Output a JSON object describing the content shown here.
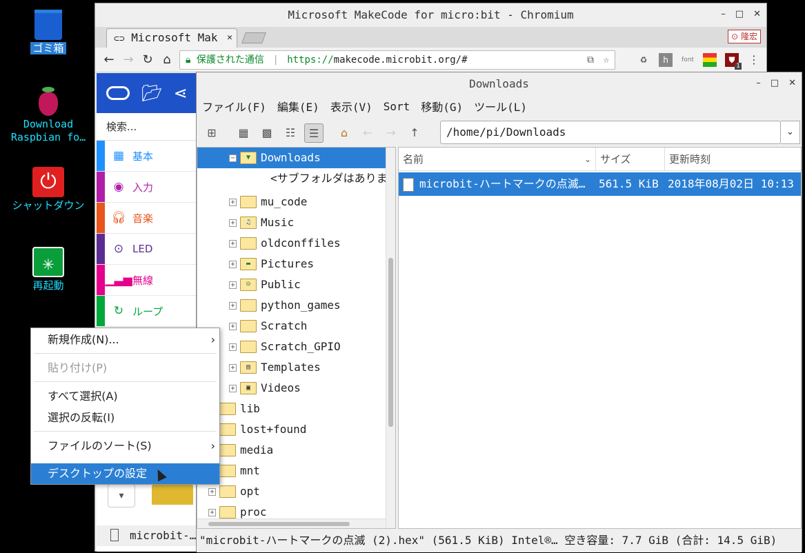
{
  "desktop": {
    "icons": [
      {
        "label": "ゴミ箱"
      },
      {
        "label": "Download Raspbian fo…"
      },
      {
        "label": "シャットダウン"
      },
      {
        "label": "再起動"
      }
    ]
  },
  "chrome": {
    "title": "Microsoft MakeCode for micro:bit - Chromium",
    "tab_label": "Microsoft Mak",
    "ext_badge": "隆宏",
    "url_secure": "保護された通信",
    "url_proto": "https://",
    "url_host": "makecode.microbit.org/#",
    "ext_font": "font",
    "ext_count": "1"
  },
  "makecode": {
    "search": "検索...",
    "categories": [
      {
        "label": "基本",
        "color": "#1e90ff"
      },
      {
        "label": "入力",
        "color": "#b01ea8"
      },
      {
        "label": "音楽",
        "color": "#e8561c"
      },
      {
        "label": "LED",
        "color": "#5c2d91"
      },
      {
        "label": "無線",
        "color": "#e3008c"
      },
      {
        "label": "ループ",
        "color": "#00a83b"
      }
    ]
  },
  "filemanager": {
    "title": "Downloads",
    "menu": [
      "ファイル(F)",
      "編集(E)",
      "表示(V)",
      "Sort",
      "移動(G)",
      "ツール(L)"
    ],
    "path": "/home/pi/Downloads",
    "tree": [
      {
        "label": "Downloads",
        "selected": true
      },
      {
        "label": "<サブフォルダはありま"
      },
      {
        "label": "mu_code"
      },
      {
        "label": "Music"
      },
      {
        "label": "oldconffiles"
      },
      {
        "label": "Pictures"
      },
      {
        "label": "Public"
      },
      {
        "label": "python_games"
      },
      {
        "label": "Scratch"
      },
      {
        "label": "Scratch_GPIO"
      },
      {
        "label": "Templates"
      },
      {
        "label": "Videos"
      },
      {
        "label": "lib"
      },
      {
        "label": "lost+found"
      },
      {
        "label": "media"
      },
      {
        "label": "mnt"
      },
      {
        "label": "opt"
      },
      {
        "label": "proc"
      }
    ],
    "columns": [
      "名前",
      "サイズ",
      "更新時刻"
    ],
    "files": [
      {
        "name": "microbit-ハートマークの点滅…",
        "size": "561.5 KiB",
        "modified": "2018年08月02日 10:13"
      }
    ],
    "status": "\"microbit-ハートマークの点滅 (2).hex\" (561.5 KiB) Intel®… 空き容量: 7.7 GiB (合計: 14.5 GiB)"
  },
  "left_status": "microbit-…",
  "context_menu": {
    "items": [
      {
        "label": "新規作成(N)...",
        "submenu": "›"
      },
      {
        "label": "貼り付け(P)",
        "disabled": true
      },
      {
        "label": "すべて選択(A)"
      },
      {
        "label": "選択の反転(I)"
      },
      {
        "label": "ファイルのソート(S)",
        "submenu": "›"
      },
      {
        "label": "デスクトップの設定",
        "selected": true
      }
    ]
  }
}
